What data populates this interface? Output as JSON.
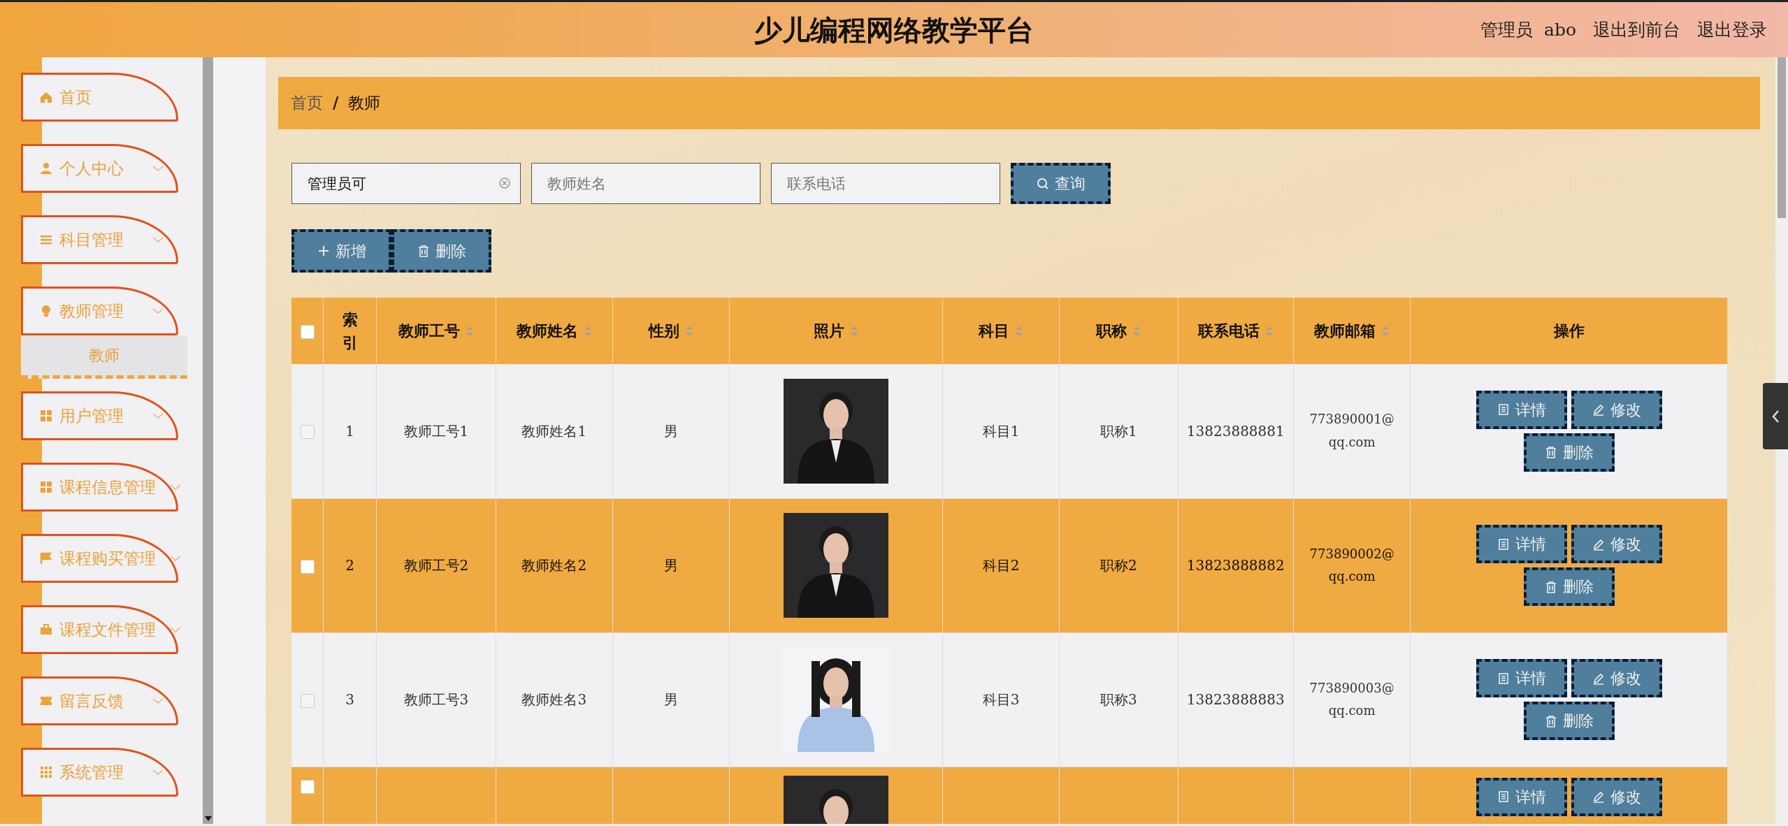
{
  "header": {
    "title": "少儿编程网络教学平台",
    "role": "管理员",
    "username": "abo",
    "links": [
      "退出到前台",
      "退出登录"
    ]
  },
  "sidebar": {
    "items": [
      {
        "label": "首页",
        "expandable": false,
        "selected": false
      },
      {
        "label": "个人中心",
        "expandable": true,
        "selected": false
      },
      {
        "label": "科目管理",
        "expandable": true,
        "selected": false
      },
      {
        "label": "教师管理",
        "expandable": true,
        "selected": false,
        "children": [
          {
            "label": "教师",
            "selected": true
          }
        ]
      },
      {
        "label": "用户管理",
        "expandable": true,
        "selected": false
      },
      {
        "label": "课程信息管理",
        "expandable": true,
        "selected": false
      },
      {
        "label": "课程购买管理",
        "expandable": true,
        "selected": false
      },
      {
        "label": "课程文件管理",
        "expandable": true,
        "selected": false
      },
      {
        "label": "留言反馈",
        "expandable": true,
        "selected": false
      },
      {
        "label": "系统管理",
        "expandable": true,
        "selected": false
      }
    ]
  },
  "breadcrumb": {
    "items": [
      "首页",
      "教师"
    ],
    "separator": "/"
  },
  "search": {
    "fields": [
      {
        "value": "管理员可",
        "clearable": true
      },
      {
        "placeholder": "教师姓名",
        "clearable": false
      },
      {
        "placeholder": "联系电话",
        "clearable": false
      }
    ],
    "button": "查询"
  },
  "actions": [
    "新增",
    "删除"
  ],
  "table": {
    "all_checked": false,
    "columns": [
      {
        "label": "索引",
        "sortable": false
      },
      {
        "label": "教师工号",
        "sortable": true
      },
      {
        "label": "教师姓名",
        "sortable": true
      },
      {
        "label": "性别",
        "sortable": true
      },
      {
        "label": "照片",
        "sortable": true
      },
      {
        "label": "科目",
        "sortable": true
      },
      {
        "label": "职称",
        "sortable": true
      },
      {
        "label": "联系电话",
        "sortable": true
      },
      {
        "label": "教师邮箱",
        "sortable": true
      },
      {
        "label": "操作",
        "sortable": false
      }
    ],
    "rows": [
      {
        "checked": false,
        "cells": [
          "1",
          "教师工号1",
          "教师姓名1",
          "男",
          {
            "kind": "picture"
          },
          "科目1",
          "职称1",
          "13823888881",
          "773890001@qq.com"
        ],
        "actions": [
          "详情",
          "修改",
          "删除"
        ]
      },
      {
        "checked": false,
        "cells": [
          "2",
          "教师工号2",
          "教师姓名2",
          "男",
          {
            "kind": "picture"
          },
          "科目2",
          "职称2",
          "13823888882",
          "773890002@qq.com"
        ],
        "actions": [
          "详情",
          "修改",
          "删除"
        ]
      },
      {
        "checked": false,
        "cells": [
          "3",
          "教师工号3",
          "教师姓名3",
          "男",
          {
            "kind": "picture"
          },
          "科目3",
          "职称3",
          "13823888883",
          "773890003@qq.com"
        ],
        "actions": [
          "详情",
          "修改",
          "删除"
        ]
      },
      {
        "checked": false,
        "cells": [
          null,
          null,
          null,
          null,
          {
            "kind": "picture"
          },
          null,
          null,
          null,
          null
        ],
        "actions": [
          "详情",
          "修改"
        ]
      }
    ]
  }
}
